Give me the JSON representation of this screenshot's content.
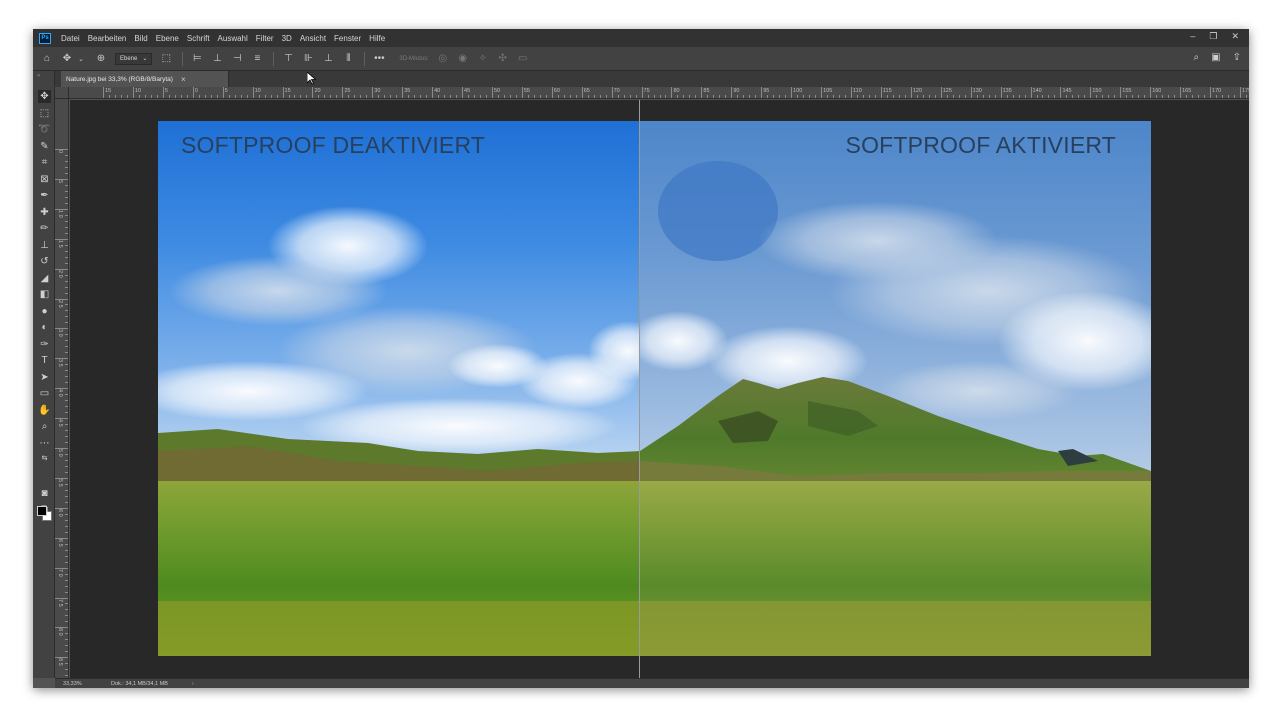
{
  "menu": {
    "logo": "Ps",
    "items": [
      "Datei",
      "Bearbeiten",
      "Bild",
      "Ebene",
      "Schrift",
      "Auswahl",
      "Filter",
      "3D",
      "Ansicht",
      "Fenster",
      "Hilfe"
    ]
  },
  "options": {
    "layer_select": "Ebene",
    "mode_label": "3D-Modus:"
  },
  "document": {
    "tab_title": "Nature.jpg bei 33,3% (RGB/8/Baryta)",
    "close_glyph": "×"
  },
  "canvas": {
    "left_label": "SOFTPROOF DEAKTIVIERT",
    "right_label": "SOFTPROOF AKTIVIERT"
  },
  "rulers": {
    "top": [
      "15",
      "10",
      "5",
      "0",
      "5",
      "10",
      "15",
      "20",
      "25",
      "30",
      "35",
      "40",
      "45",
      "50",
      "55",
      "60",
      "65",
      "70",
      "75",
      "80",
      "85",
      "90",
      "95",
      "100",
      "105",
      "110",
      "115",
      "120",
      "125",
      "130",
      "135",
      "140",
      "145",
      "150",
      "155",
      "160",
      "165",
      "170",
      "175"
    ],
    "left": [
      "0",
      "5",
      "1 0",
      "1 5",
      "2 0",
      "2 5",
      "3 0",
      "3 5",
      "4 0",
      "4 5",
      "5 0",
      "5 5",
      "6 0",
      "6 5",
      "7 0",
      "7 5",
      "8 0",
      "8 5",
      "9 0"
    ]
  },
  "status": {
    "zoom": "33,33%",
    "doc_info": "Dok.: 34,1 MB/34,1 MB",
    "arrow": "›"
  },
  "icons": {
    "home": "home-icon",
    "move": "move-icon",
    "search": "search-icon",
    "share": "share-icon",
    "workspace": "workspace-icon"
  },
  "colors": {
    "foreground": "#000000",
    "background": "#ffffff",
    "overlay_text": "#27405f"
  }
}
